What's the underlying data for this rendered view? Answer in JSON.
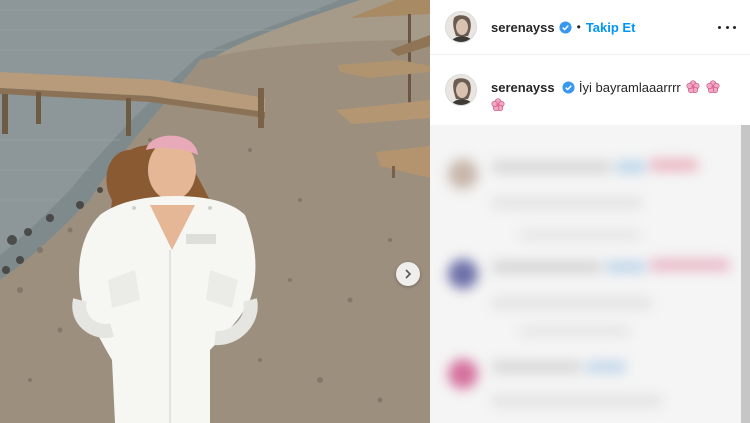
{
  "post": {
    "username": "serenayss",
    "separator": "•",
    "follow_label": "Takip Et",
    "caption_user": "serenayss",
    "caption_text": "İyi bayramlaaarrrr"
  },
  "colors": {
    "follow_blue": "#0095f6",
    "verified_blue": "#3897f0",
    "text": "#262626",
    "bandana_pink": "#e8a9b8"
  },
  "icons": {
    "verified": "verified-badge-icon",
    "more": "more-options-icon",
    "next": "carousel-next-icon",
    "emoji": "cherry-blossom-emoji"
  }
}
